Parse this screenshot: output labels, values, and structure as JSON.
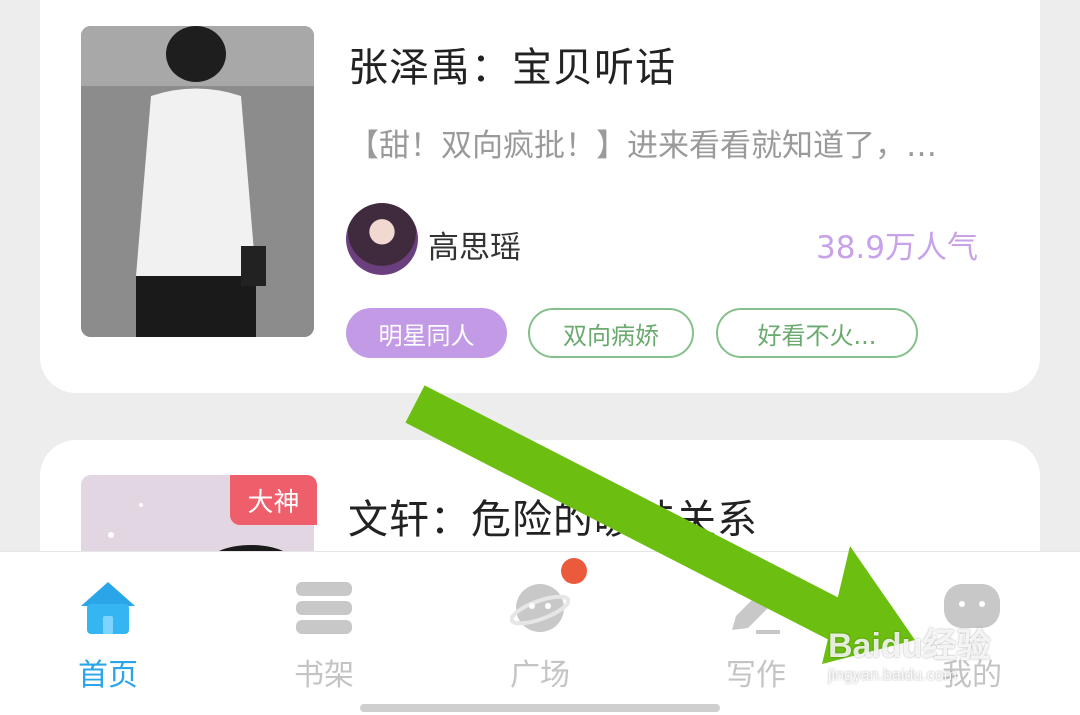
{
  "cards": [
    {
      "title": "张泽禹：宝贝听话",
      "description": "【甜！双向疯批！】进来看看就知道了，…",
      "author": "高思瑶",
      "popularity": "38.9万人气",
      "tags": [
        "明星同人",
        "双向病娇",
        "好看不火..."
      ]
    },
    {
      "badge": "大神",
      "title": "文轩：危险的暧昧关系"
    }
  ],
  "nav": {
    "items": [
      {
        "label": "首页",
        "icon": "home-icon",
        "active": true
      },
      {
        "label": "书架",
        "icon": "bookshelf-icon"
      },
      {
        "label": "广场",
        "icon": "planet-icon",
        "has_notification": true
      },
      {
        "label": "写作",
        "icon": "pencil-icon"
      },
      {
        "label": "我的",
        "icon": "profile-face-icon"
      }
    ]
  },
  "watermark": {
    "main": "Baidu经验",
    "sub": "jingyan.baidu.com"
  },
  "colors": {
    "accent_blue": "#2aa5e8",
    "tag_purple": "#c39ae6",
    "tag_green": "#86c08c",
    "badge_red": "#ef5e6b",
    "arrow_green": "#6cbf10"
  }
}
